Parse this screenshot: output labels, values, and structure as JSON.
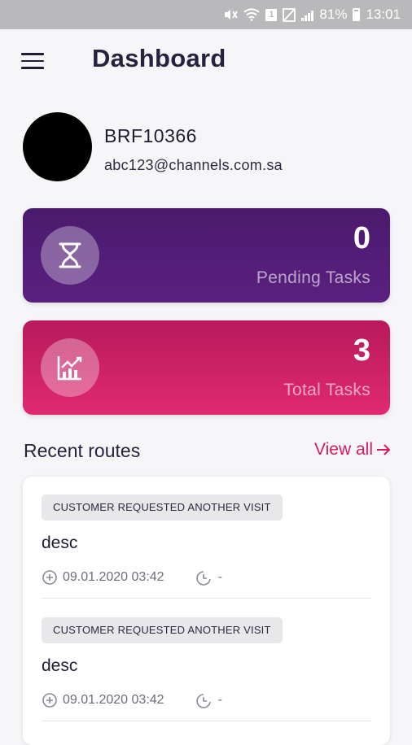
{
  "status_bar": {
    "battery": "81%",
    "time": "13:01",
    "notification_count": "1"
  },
  "header": {
    "title": "Dashboard"
  },
  "profile": {
    "user_id": "BRF10366",
    "email": "abc123@channels.com.sa"
  },
  "stats": {
    "pending": {
      "value": "0",
      "label": "Pending Tasks",
      "icon": "hourglass-icon"
    },
    "total": {
      "value": "3",
      "label": "Total Tasks",
      "icon": "chart-growth-icon"
    }
  },
  "recent_routes": {
    "title": "Recent routes",
    "view_all": "View all",
    "items": [
      {
        "badge": "CUSTOMER REQUESTED ANOTHER VISIT",
        "desc": "desc",
        "date": "09.01.2020 03:42",
        "duration": "-"
      },
      {
        "badge": "CUSTOMER REQUESTED ANOTHER VISIT",
        "desc": "desc",
        "date": "09.01.2020 03:42",
        "duration": "-"
      }
    ]
  },
  "colors": {
    "pending_card": "#4a1a6d",
    "total_card": "#d81b5c",
    "accent": "#d81b5c",
    "title": "#26233f"
  }
}
